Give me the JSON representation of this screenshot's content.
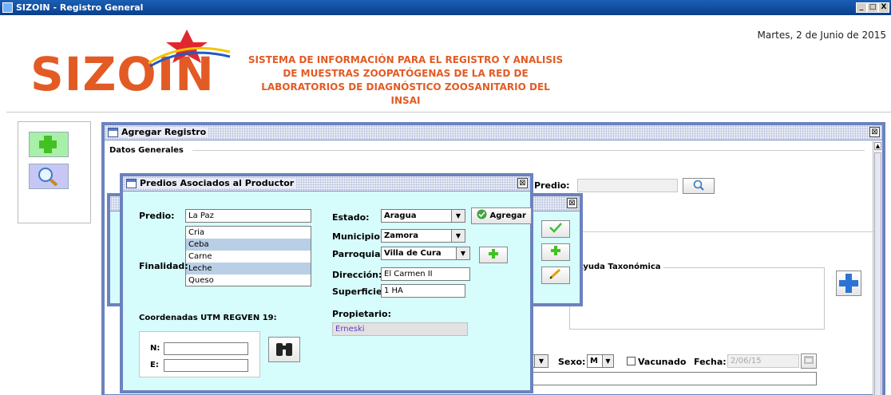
{
  "window": {
    "title": "SIZOIN - Registro General",
    "controls": [
      "_",
      "□",
      "X"
    ]
  },
  "header": {
    "date": "Martes, 2 de Junio de 2015",
    "logo": "SIZOIN",
    "headline": [
      "SISTEMA DE INFORMACIÓN PARA EL REGISTRO Y ANALISIS",
      "DE MUESTRAS ZOOPATÓGENAS DE LA RED DE",
      "LABORATORIOS DE DIAGNÓSTICO ZOOSANITARIO DEL INSAI"
    ]
  },
  "sidebar": {
    "buttons": [
      {
        "icon": "plus-icon"
      },
      {
        "icon": "magnifier-icon"
      }
    ]
  },
  "agregar": {
    "title": "Agregar Registro",
    "datos_generales": "Datos Generales",
    "predio_label": "Predio:",
    "ayuda": "Ayuda Taxonómica",
    "sexo_label": "Sexo:",
    "sexo_value": "M",
    "vacunado": "Vacunado",
    "fecha_label": "Fecha:",
    "fecha_value": "2/06/15"
  },
  "predios": {
    "title": "Predios Asociados al Productor",
    "predio_label": "Predio:",
    "predio_value": "La Paz",
    "finalidad_label": "Finalidad:",
    "finalidad_items": [
      {
        "text": "Cria",
        "selected": false
      },
      {
        "text": "Ceba",
        "selected": true
      },
      {
        "text": "Carne",
        "selected": false
      },
      {
        "text": "Leche",
        "selected": true
      },
      {
        "text": "Queso",
        "selected": false
      }
    ],
    "estado_label": "Estado:",
    "estado_value": "Aragua",
    "agregar_button": "Agregar",
    "municipio_label": "Municipio:",
    "municipio_value": "Zamora",
    "parroquia_label": "Parroquia:",
    "parroquia_value": "Villa de Cura",
    "direccion_label": "Dirección:",
    "direccion_value": "El Carmen II",
    "superficie_label": "Superficie:",
    "superficie_value": "1 HA",
    "coords_label": "Coordenadas UTM REGVEN 19:",
    "n_label": "N:",
    "e_label": "E:",
    "n_value": "",
    "e_value": "",
    "propietario_label": "Propietario:",
    "propietario_value": "Erneski"
  },
  "colors": {
    "accent": "#e35b24",
    "title_bar": "#0a3f8c",
    "dialog_bg": "#d6fcfc",
    "frame": "#6b82be"
  }
}
